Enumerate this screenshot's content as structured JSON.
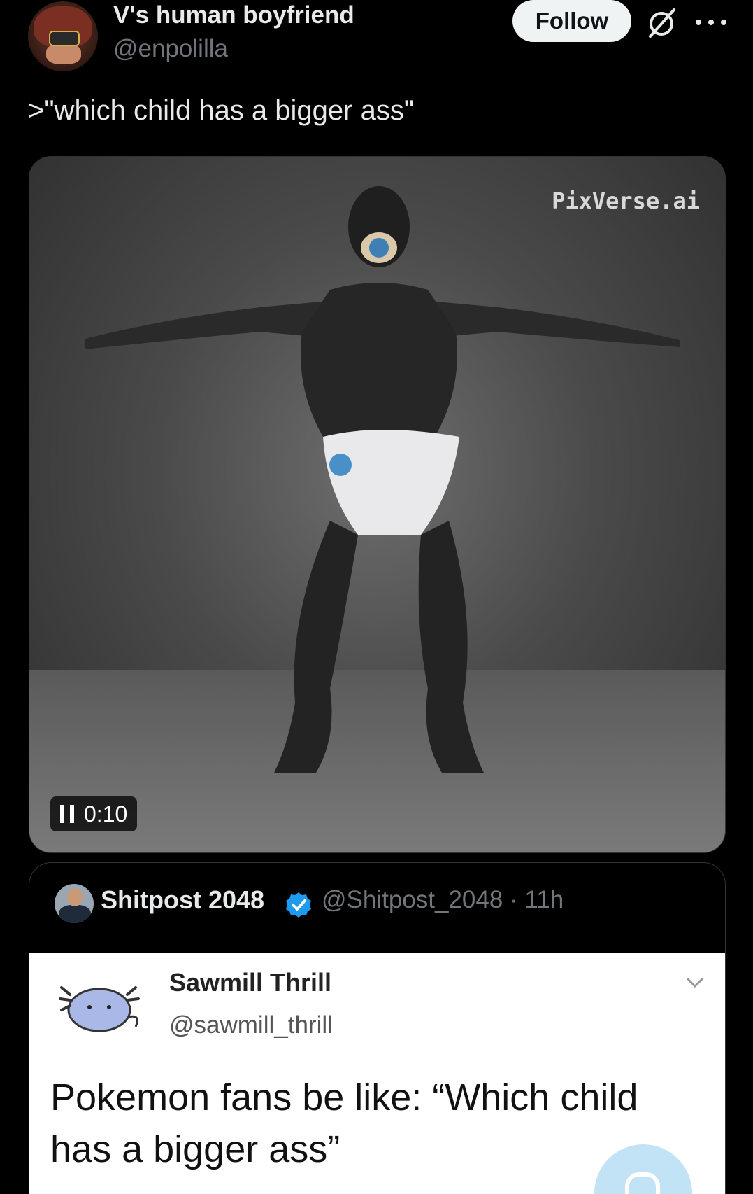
{
  "author": {
    "name": "V's human boyfriend",
    "handle": "@enpolilla",
    "follow_label": "Follow"
  },
  "icons": {
    "grok": "grok-icon",
    "more": "more-icon",
    "pause": "pause-icon",
    "verified": "verified-badge-icon",
    "chevron": "chevron-down-icon"
  },
  "tweet": {
    "text": ">\"which child has a bigger ass\""
  },
  "media": {
    "watermark": "PixVerse.ai",
    "timer": "0:10"
  },
  "quote": {
    "name": "Shitpost 2048",
    "handle_time": "@Shitpost_2048 · 11h",
    "embedded": {
      "name": "Sawmill Thrill",
      "handle": "@sawmill_thrill",
      "text": "Pokemon fans be like: “Which child has a bigger ass”"
    }
  },
  "colors": {
    "background": "#000000",
    "follow_bg": "#eff3f4",
    "secondary_text": "#71767b",
    "verified": "#1d9bf0"
  }
}
